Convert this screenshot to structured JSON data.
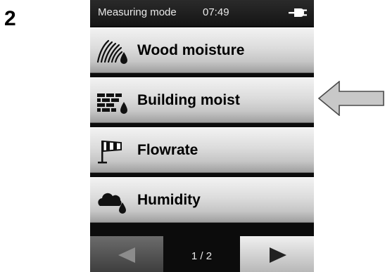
{
  "step_number": "2",
  "status_bar": {
    "title": "Measuring mode",
    "time": "07:49",
    "power_icon": "plug-icon"
  },
  "menu": {
    "items": [
      {
        "label": "Wood moisture",
        "icon": "wood-moisture-icon"
      },
      {
        "label": "Building moist",
        "icon": "building-moisture-icon"
      },
      {
        "label": "Flowrate",
        "icon": "windsock-icon"
      },
      {
        "label": "Humidity",
        "icon": "cloud-drop-icon"
      }
    ],
    "highlighted_item": "Building moist"
  },
  "pager": {
    "page_indicator": "1 / 2",
    "prev_icon": "arrow-left-icon",
    "next_icon": "arrow-right-icon"
  },
  "colors": {
    "screen_background": "#0c0c0c",
    "button_light": "#f2f2f2",
    "button_dark": "#9f9f9f",
    "pointer_arrow_fill": "#c8c8c8"
  }
}
